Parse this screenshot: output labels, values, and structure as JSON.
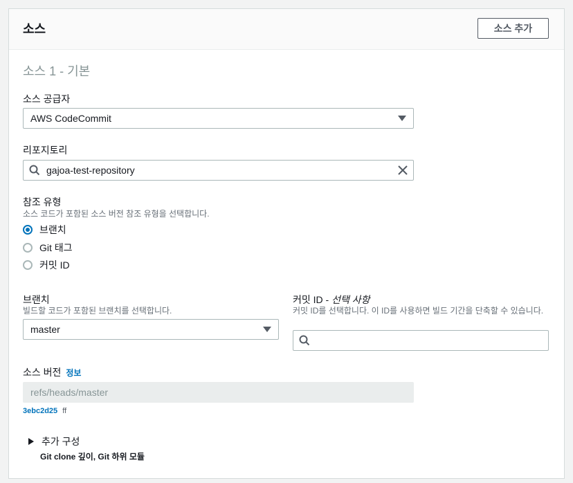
{
  "header": {
    "title": "소스",
    "add_button": "소스 추가"
  },
  "section": {
    "title": "소스 1 - 기본"
  },
  "provider": {
    "label": "소스 공급자",
    "value": "AWS CodeCommit"
  },
  "repository": {
    "label": "리포지토리",
    "value": "gajoa-test-repository"
  },
  "ref_type": {
    "label": "참조 유형",
    "description": "소스 코드가 포함된 소스 버전 참조 유형을 선택합니다.",
    "options": [
      {
        "label": "브랜치",
        "checked": true
      },
      {
        "label": "Git 태그",
        "checked": false
      },
      {
        "label": "커밋 ID",
        "checked": false
      }
    ]
  },
  "branch": {
    "label": "브랜치",
    "description": "빌드할 코드가 포함된 브랜치를 선택합니다.",
    "value": "master"
  },
  "commit": {
    "label": "커밋 ID - ",
    "label_optional": "선택 사항",
    "description": "커밋 ID를 선택합니다. 이 ID를 사용하면 빌드 기간을 단축할 수 있습니다.",
    "value": ""
  },
  "source_version": {
    "label": "소스 버전",
    "info_link": "정보",
    "value": "refs/heads/master",
    "commit_hash": "3ebc2d25",
    "commit_suffix": "ff"
  },
  "additional": {
    "title": "추가 구성",
    "subtitle": "Git clone 깊이, Git 하위 모듈"
  }
}
